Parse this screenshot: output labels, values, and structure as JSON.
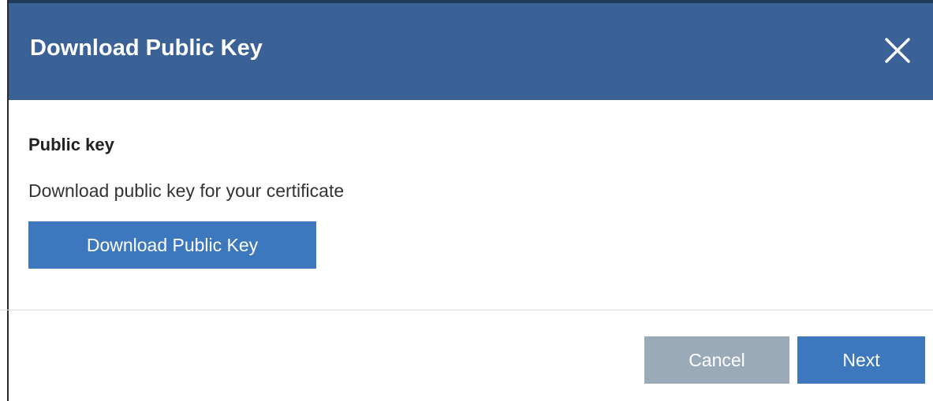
{
  "dialog": {
    "title": "Download Public Key",
    "close_icon": "close-icon"
  },
  "content": {
    "section_title": "Public key",
    "description": "Download public key for your certificate",
    "download_button_label": "Download Public Key"
  },
  "footer": {
    "cancel_label": "Cancel",
    "next_label": "Next"
  },
  "colors": {
    "header_bg": "#3a6296",
    "header_top_border": "#203a5c",
    "primary_button": "#3d78bf",
    "cancel_button": "#9aaab8",
    "next_button": "#3d78bf"
  }
}
